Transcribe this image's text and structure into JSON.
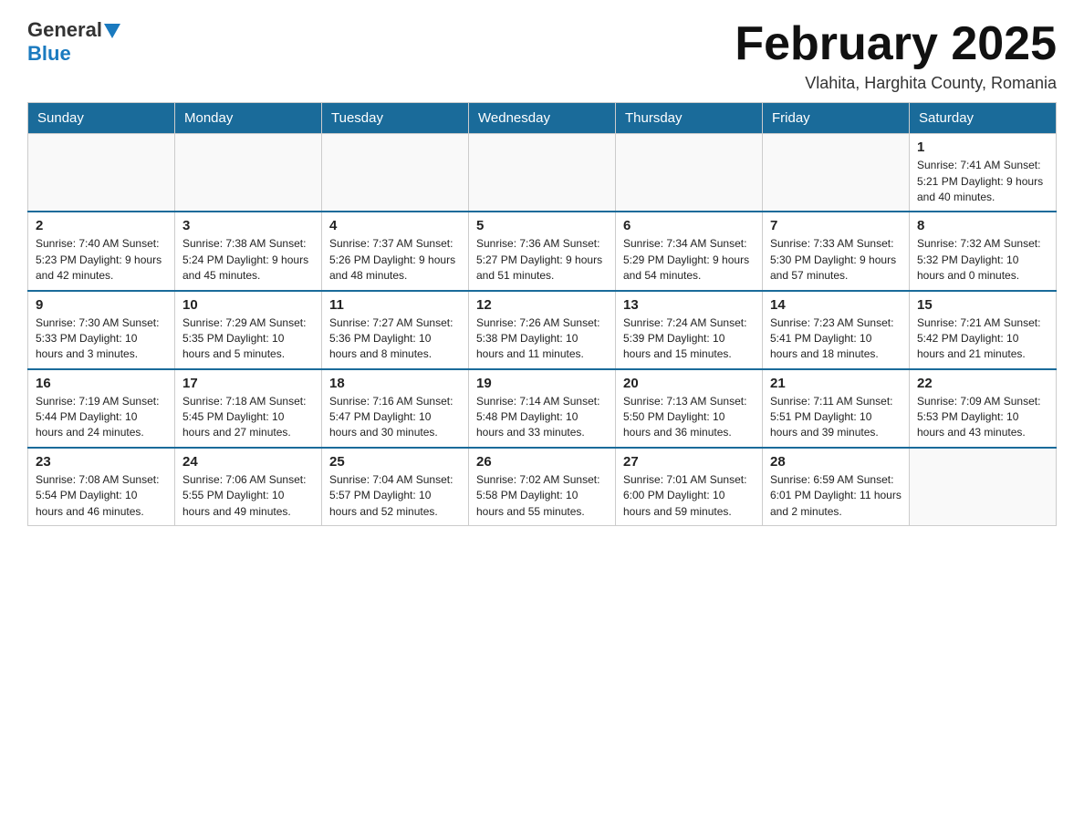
{
  "header": {
    "logo_general": "General",
    "logo_blue": "Blue",
    "month_title": "February 2025",
    "location": "Vlahita, Harghita County, Romania"
  },
  "days_of_week": [
    "Sunday",
    "Monday",
    "Tuesday",
    "Wednesday",
    "Thursday",
    "Friday",
    "Saturday"
  ],
  "weeks": [
    [
      {
        "day": "",
        "info": ""
      },
      {
        "day": "",
        "info": ""
      },
      {
        "day": "",
        "info": ""
      },
      {
        "day": "",
        "info": ""
      },
      {
        "day": "",
        "info": ""
      },
      {
        "day": "",
        "info": ""
      },
      {
        "day": "1",
        "info": "Sunrise: 7:41 AM\nSunset: 5:21 PM\nDaylight: 9 hours and 40 minutes."
      }
    ],
    [
      {
        "day": "2",
        "info": "Sunrise: 7:40 AM\nSunset: 5:23 PM\nDaylight: 9 hours and 42 minutes."
      },
      {
        "day": "3",
        "info": "Sunrise: 7:38 AM\nSunset: 5:24 PM\nDaylight: 9 hours and 45 minutes."
      },
      {
        "day": "4",
        "info": "Sunrise: 7:37 AM\nSunset: 5:26 PM\nDaylight: 9 hours and 48 minutes."
      },
      {
        "day": "5",
        "info": "Sunrise: 7:36 AM\nSunset: 5:27 PM\nDaylight: 9 hours and 51 minutes."
      },
      {
        "day": "6",
        "info": "Sunrise: 7:34 AM\nSunset: 5:29 PM\nDaylight: 9 hours and 54 minutes."
      },
      {
        "day": "7",
        "info": "Sunrise: 7:33 AM\nSunset: 5:30 PM\nDaylight: 9 hours and 57 minutes."
      },
      {
        "day": "8",
        "info": "Sunrise: 7:32 AM\nSunset: 5:32 PM\nDaylight: 10 hours and 0 minutes."
      }
    ],
    [
      {
        "day": "9",
        "info": "Sunrise: 7:30 AM\nSunset: 5:33 PM\nDaylight: 10 hours and 3 minutes."
      },
      {
        "day": "10",
        "info": "Sunrise: 7:29 AM\nSunset: 5:35 PM\nDaylight: 10 hours and 5 minutes."
      },
      {
        "day": "11",
        "info": "Sunrise: 7:27 AM\nSunset: 5:36 PM\nDaylight: 10 hours and 8 minutes."
      },
      {
        "day": "12",
        "info": "Sunrise: 7:26 AM\nSunset: 5:38 PM\nDaylight: 10 hours and 11 minutes."
      },
      {
        "day": "13",
        "info": "Sunrise: 7:24 AM\nSunset: 5:39 PM\nDaylight: 10 hours and 15 minutes."
      },
      {
        "day": "14",
        "info": "Sunrise: 7:23 AM\nSunset: 5:41 PM\nDaylight: 10 hours and 18 minutes."
      },
      {
        "day": "15",
        "info": "Sunrise: 7:21 AM\nSunset: 5:42 PM\nDaylight: 10 hours and 21 minutes."
      }
    ],
    [
      {
        "day": "16",
        "info": "Sunrise: 7:19 AM\nSunset: 5:44 PM\nDaylight: 10 hours and 24 minutes."
      },
      {
        "day": "17",
        "info": "Sunrise: 7:18 AM\nSunset: 5:45 PM\nDaylight: 10 hours and 27 minutes."
      },
      {
        "day": "18",
        "info": "Sunrise: 7:16 AM\nSunset: 5:47 PM\nDaylight: 10 hours and 30 minutes."
      },
      {
        "day": "19",
        "info": "Sunrise: 7:14 AM\nSunset: 5:48 PM\nDaylight: 10 hours and 33 minutes."
      },
      {
        "day": "20",
        "info": "Sunrise: 7:13 AM\nSunset: 5:50 PM\nDaylight: 10 hours and 36 minutes."
      },
      {
        "day": "21",
        "info": "Sunrise: 7:11 AM\nSunset: 5:51 PM\nDaylight: 10 hours and 39 minutes."
      },
      {
        "day": "22",
        "info": "Sunrise: 7:09 AM\nSunset: 5:53 PM\nDaylight: 10 hours and 43 minutes."
      }
    ],
    [
      {
        "day": "23",
        "info": "Sunrise: 7:08 AM\nSunset: 5:54 PM\nDaylight: 10 hours and 46 minutes."
      },
      {
        "day": "24",
        "info": "Sunrise: 7:06 AM\nSunset: 5:55 PM\nDaylight: 10 hours and 49 minutes."
      },
      {
        "day": "25",
        "info": "Sunrise: 7:04 AM\nSunset: 5:57 PM\nDaylight: 10 hours and 52 minutes."
      },
      {
        "day": "26",
        "info": "Sunrise: 7:02 AM\nSunset: 5:58 PM\nDaylight: 10 hours and 55 minutes."
      },
      {
        "day": "27",
        "info": "Sunrise: 7:01 AM\nSunset: 6:00 PM\nDaylight: 10 hours and 59 minutes."
      },
      {
        "day": "28",
        "info": "Sunrise: 6:59 AM\nSunset: 6:01 PM\nDaylight: 11 hours and 2 minutes."
      },
      {
        "day": "",
        "info": ""
      }
    ]
  ]
}
